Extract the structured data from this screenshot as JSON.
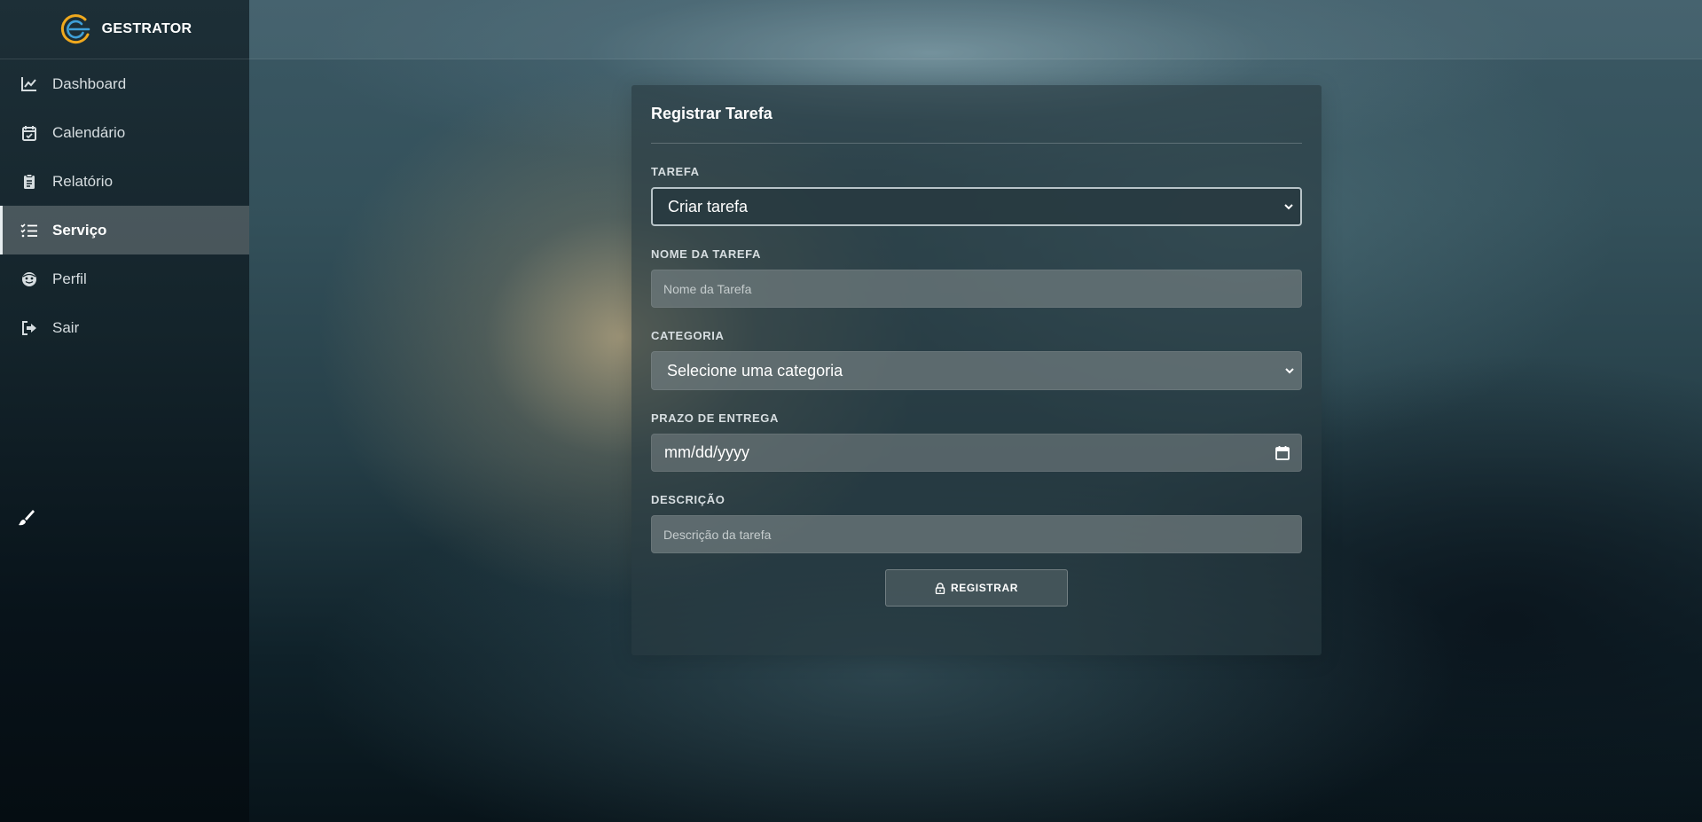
{
  "app": {
    "brand_name": "GESTRATOR",
    "logo_icon": "gestrator-logo",
    "accent_color": "#f0a91e",
    "logo_secondary_color": "#3fa0d8"
  },
  "sidebar": {
    "items": [
      {
        "label": "Dashboard",
        "icon": "line-chart-icon",
        "active": false
      },
      {
        "label": "Calendário",
        "icon": "calendar-check-icon",
        "active": false
      },
      {
        "label": "Relatório",
        "icon": "clipboard-icon",
        "active": false
      },
      {
        "label": "Serviço",
        "icon": "task-list-icon",
        "active": true
      },
      {
        "label": "Perfil",
        "icon": "face-icon",
        "active": false
      },
      {
        "label": "Sair",
        "icon": "sign-out-icon",
        "active": false
      }
    ],
    "tool_icon": "paint-brush-icon"
  },
  "form": {
    "title": "Registrar Tarefa",
    "tarefa": {
      "label": "TAREFA",
      "selected": "Criar tarefa"
    },
    "nome": {
      "label": "NOME DA TAREFA",
      "placeholder": "Nome da Tarefa",
      "value": ""
    },
    "categoria": {
      "label": "CATEGORIA",
      "selected": "Selecione uma categoria"
    },
    "prazo": {
      "label": "PRAZO DE ENTREGA",
      "display": "mm/dd/yyyy"
    },
    "descricao": {
      "label": "DESCRIÇÃO",
      "placeholder": "Descrição da tarefa",
      "value": ""
    },
    "submit": {
      "label": "REGISTRAR",
      "icon": "lock-icon"
    }
  }
}
